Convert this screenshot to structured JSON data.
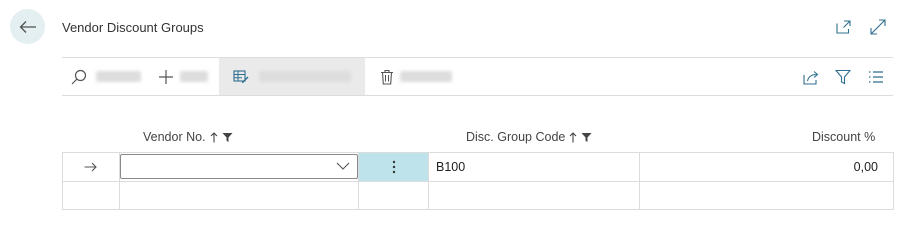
{
  "header": {
    "title": "Vendor Discount Groups",
    "back_icon": "arrow-left-icon",
    "icons": [
      "open-in-new-window-icon",
      "expand-icon"
    ]
  },
  "toolbar": {
    "icons": [
      "search-icon",
      "plus-icon",
      "edit-list-icon",
      "trash-icon",
      "share-icon",
      "filter-icon",
      "list-view-icon"
    ]
  },
  "columns": {
    "vendor_no": "Vendor No.",
    "disc_group_code": "Disc. Group Code",
    "discount_pct": "Discount %"
  },
  "rows": [
    {
      "vendor_no": "",
      "disc_group_code": "B100",
      "discount_pct": "0,00"
    }
  ],
  "colors": {
    "accent": "#bfe3ea",
    "back_bg": "#e3eff1"
  }
}
